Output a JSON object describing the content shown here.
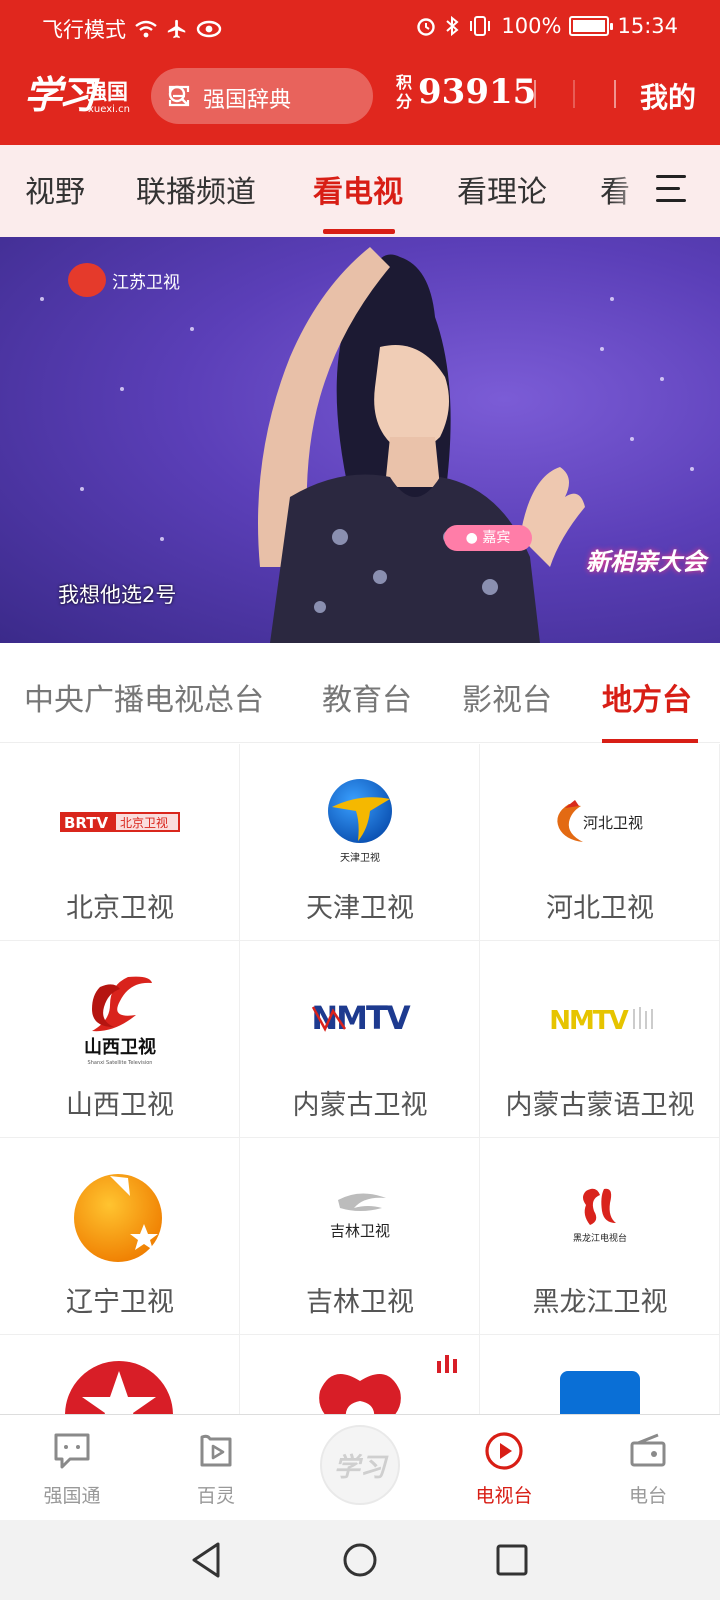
{
  "status_bar": {
    "airplane_mode": "飞行模式",
    "battery": "100%",
    "time": "15:34"
  },
  "header": {
    "logo_script": "学习",
    "logo_name": "强国",
    "logo_url": "xuexi.cn",
    "search_placeholder": "强国辞典",
    "points_label": "积分",
    "points_value": "93915",
    "mine": "我的"
  },
  "nav_tabs": [
    {
      "label": "视野",
      "active": false
    },
    {
      "label": "联播频道",
      "active": false
    },
    {
      "label": "看电视",
      "active": true
    },
    {
      "label": "看理论",
      "active": false
    },
    {
      "label": "看",
      "active": false
    }
  ],
  "video": {
    "channel_logo_text": "江苏卫视",
    "subtitle": "我想他选2号",
    "show_logo": "新相亲大会"
  },
  "sub_tabs": [
    {
      "label": "中央广播电视总台",
      "active": false
    },
    {
      "label": "教育台",
      "active": false
    },
    {
      "label": "影视台",
      "active": false
    },
    {
      "label": "地方台",
      "active": true
    }
  ],
  "channels": [
    {
      "name": "北京卫视",
      "logo_text": "BRTV",
      "logo_sub": "北京卫视",
      "icon": "brtv-logo"
    },
    {
      "name": "天津卫视",
      "logo_sub": "天津卫视",
      "icon": "tianjin-tv-logo"
    },
    {
      "name": "河北卫视",
      "logo_sub": "河北卫视",
      "icon": "hebei-tv-logo"
    },
    {
      "name": "山西卫视",
      "logo_sub": "山西卫视",
      "logo_en": "Shanxi Satellite Television",
      "icon": "shanxi-tv-logo"
    },
    {
      "name": "内蒙古卫视",
      "logo_text": "NMTV",
      "icon": "nmtv-logo"
    },
    {
      "name": "内蒙古蒙语卫视",
      "logo_text": "NMTV",
      "icon": "nmtv-mongolian-logo"
    },
    {
      "name": "辽宁卫视",
      "icon": "liaoning-tv-logo"
    },
    {
      "name": "吉林卫视",
      "logo_sub": "吉林卫视",
      "icon": "jilin-tv-logo"
    },
    {
      "name": "黑龙江卫视",
      "logo_sub": "黑龙江电视台",
      "icon": "heilongjiang-tv-logo"
    }
  ],
  "bottom_tabs": [
    {
      "label": "强国通",
      "icon": "chat-icon",
      "active": false
    },
    {
      "label": "百灵",
      "icon": "baling-play-icon",
      "active": false
    },
    {
      "label": "学习",
      "icon": "xuexi-center-icon",
      "active": false
    },
    {
      "label": "电视台",
      "icon": "tv-play-icon",
      "active": true
    },
    {
      "label": "电台",
      "icon": "radio-icon",
      "active": false
    }
  ],
  "colors": {
    "brand_red": "#e0271e",
    "active_red": "#d81e15",
    "nav_bg": "#fbecec"
  }
}
